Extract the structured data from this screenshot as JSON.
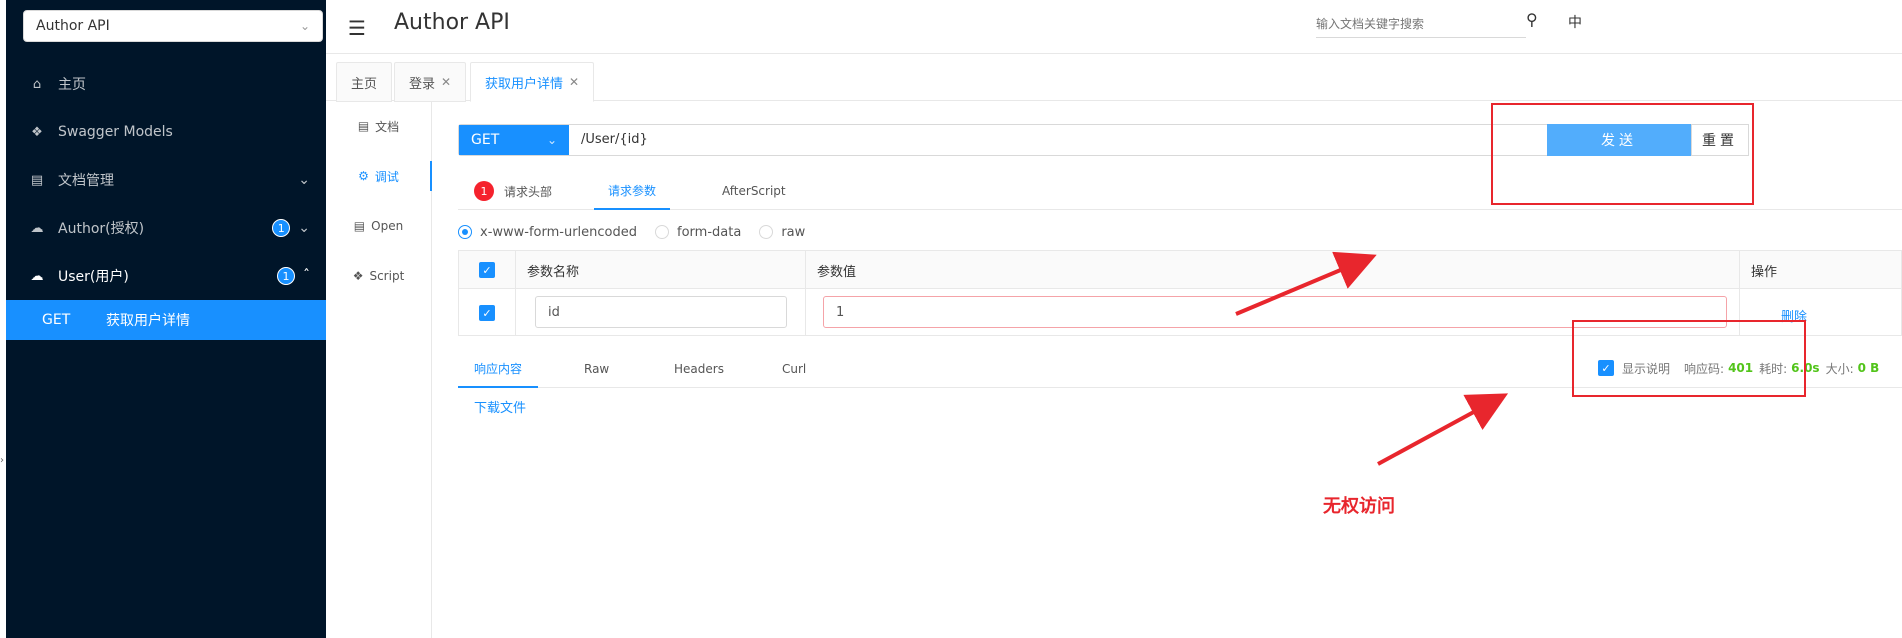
{
  "sidebar": {
    "api_select": "Author API",
    "items": [
      {
        "label": "主页",
        "icon": "home-icon"
      },
      {
        "label": "Swagger Models",
        "icon": "cube-icon"
      },
      {
        "label": "文档管理",
        "icon": "document-settings-icon"
      },
      {
        "label": "Author(授权)",
        "icon": "cloud-icon",
        "badge": "1"
      },
      {
        "label": "User(用户)",
        "icon": "cloud-icon",
        "badge": "1"
      }
    ],
    "sub_item": {
      "method": "GET",
      "label": "获取用户详情"
    }
  },
  "header": {
    "title": "Author API",
    "search_placeholder": "输入文档关键字搜索",
    "lang": "中"
  },
  "tabs": [
    {
      "label": "主页"
    },
    {
      "label": "登录"
    },
    {
      "label": "获取用户详情"
    }
  ],
  "vnav": [
    {
      "label": "文档",
      "icon": "document-icon"
    },
    {
      "label": "调试",
      "icon": "bug-icon"
    },
    {
      "label": "Open",
      "icon": "file-icon"
    },
    {
      "label": "Script",
      "icon": "script-icon"
    }
  ],
  "request": {
    "method": "GET",
    "url": "/User/{id}",
    "send_label": "发送",
    "reset_label": "重置"
  },
  "request_tabs": {
    "headers_badge": "1",
    "headers": "请求头部",
    "params": "请求参数",
    "afterscript": "AfterScript"
  },
  "content_types": [
    "x-www-form-urlencoded",
    "form-data",
    "raw"
  ],
  "params_table": {
    "col_name": "参数名称",
    "col_value": "参数值",
    "col_action": "操作",
    "rows": [
      {
        "name": "id",
        "value": "1",
        "action": "删除"
      }
    ]
  },
  "response_tabs": [
    "响应内容",
    "Raw",
    "Headers",
    "Curl"
  ],
  "response_info": {
    "show_desc": "显示说明",
    "code_label": "响应码:",
    "code": "401",
    "time_label": "耗时:",
    "time": "6.0s",
    "size_label": "大小:",
    "size": "0 B"
  },
  "download_label": "下载文件",
  "annotation": {
    "text": "无权访问",
    "color": "#e8262d"
  },
  "colors": {
    "sidebar_bg": "#001529",
    "primary": "#1890ff",
    "send_btn": "#52adfc",
    "success": "#52c41a"
  }
}
